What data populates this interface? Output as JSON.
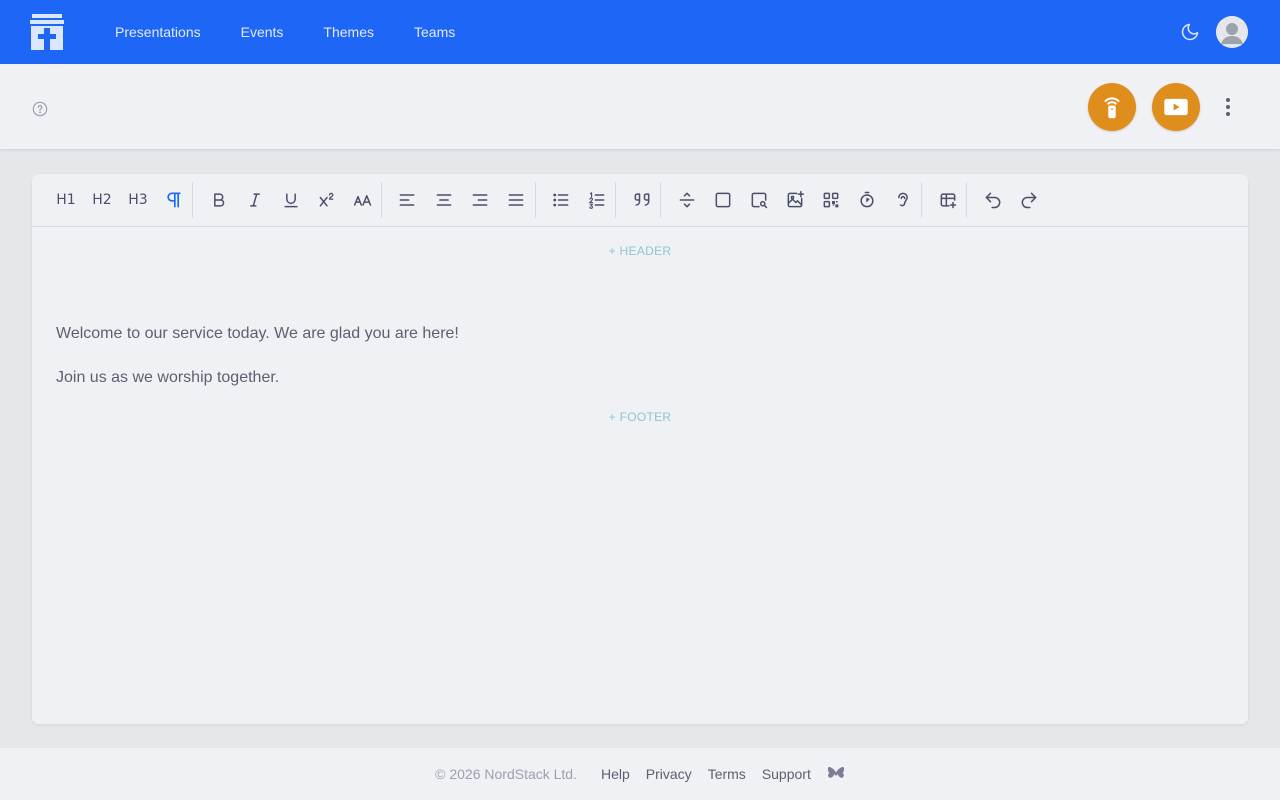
{
  "nav": {
    "links": [
      "Presentations",
      "Events",
      "Themes",
      "Teams"
    ]
  },
  "toolbar": {
    "h1": "H1",
    "h2": "H2",
    "h3": "H3"
  },
  "editor": {
    "add_header": "+ HEADER",
    "add_footer": "+ FOOTER",
    "paragraphs": [
      "Welcome to our service today. We are glad you are here!",
      "Join us as we worship together."
    ]
  },
  "footer": {
    "copyright": "© 2026 NordStack Ltd.",
    "links": [
      "Help",
      "Privacy",
      "Terms",
      "Support"
    ]
  },
  "colors": {
    "brand_blue": "#1e66f5",
    "accent_orange": "#df8e1d",
    "active_tool": "#1e66f5"
  },
  "icons": [
    "logo-icon",
    "moon-icon",
    "avatar",
    "help-icon",
    "remote-icon",
    "play-icon",
    "more-vertical-icon",
    "butterfly-icon"
  ]
}
